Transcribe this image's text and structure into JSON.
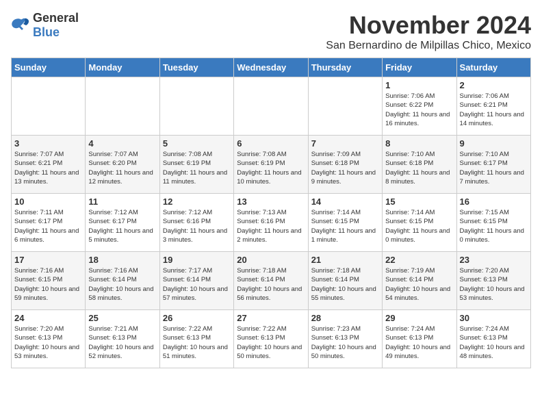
{
  "logo": {
    "general": "General",
    "blue": "Blue"
  },
  "title": "November 2024",
  "subtitle": "San Bernardino de Milpillas Chico, Mexico",
  "headers": [
    "Sunday",
    "Monday",
    "Tuesday",
    "Wednesday",
    "Thursday",
    "Friday",
    "Saturday"
  ],
  "weeks": [
    [
      {
        "day": "",
        "info": ""
      },
      {
        "day": "",
        "info": ""
      },
      {
        "day": "",
        "info": ""
      },
      {
        "day": "",
        "info": ""
      },
      {
        "day": "",
        "info": ""
      },
      {
        "day": "1",
        "info": "Sunrise: 7:06 AM\nSunset: 6:22 PM\nDaylight: 11 hours and 16 minutes."
      },
      {
        "day": "2",
        "info": "Sunrise: 7:06 AM\nSunset: 6:21 PM\nDaylight: 11 hours and 14 minutes."
      }
    ],
    [
      {
        "day": "3",
        "info": "Sunrise: 7:07 AM\nSunset: 6:21 PM\nDaylight: 11 hours and 13 minutes."
      },
      {
        "day": "4",
        "info": "Sunrise: 7:07 AM\nSunset: 6:20 PM\nDaylight: 11 hours and 12 minutes."
      },
      {
        "day": "5",
        "info": "Sunrise: 7:08 AM\nSunset: 6:19 PM\nDaylight: 11 hours and 11 minutes."
      },
      {
        "day": "6",
        "info": "Sunrise: 7:08 AM\nSunset: 6:19 PM\nDaylight: 11 hours and 10 minutes."
      },
      {
        "day": "7",
        "info": "Sunrise: 7:09 AM\nSunset: 6:18 PM\nDaylight: 11 hours and 9 minutes."
      },
      {
        "day": "8",
        "info": "Sunrise: 7:10 AM\nSunset: 6:18 PM\nDaylight: 11 hours and 8 minutes."
      },
      {
        "day": "9",
        "info": "Sunrise: 7:10 AM\nSunset: 6:17 PM\nDaylight: 11 hours and 7 minutes."
      }
    ],
    [
      {
        "day": "10",
        "info": "Sunrise: 7:11 AM\nSunset: 6:17 PM\nDaylight: 11 hours and 6 minutes."
      },
      {
        "day": "11",
        "info": "Sunrise: 7:12 AM\nSunset: 6:17 PM\nDaylight: 11 hours and 5 minutes."
      },
      {
        "day": "12",
        "info": "Sunrise: 7:12 AM\nSunset: 6:16 PM\nDaylight: 11 hours and 3 minutes."
      },
      {
        "day": "13",
        "info": "Sunrise: 7:13 AM\nSunset: 6:16 PM\nDaylight: 11 hours and 2 minutes."
      },
      {
        "day": "14",
        "info": "Sunrise: 7:14 AM\nSunset: 6:15 PM\nDaylight: 11 hours and 1 minute."
      },
      {
        "day": "15",
        "info": "Sunrise: 7:14 AM\nSunset: 6:15 PM\nDaylight: 11 hours and 0 minutes."
      },
      {
        "day": "16",
        "info": "Sunrise: 7:15 AM\nSunset: 6:15 PM\nDaylight: 11 hours and 0 minutes."
      }
    ],
    [
      {
        "day": "17",
        "info": "Sunrise: 7:16 AM\nSunset: 6:15 PM\nDaylight: 10 hours and 59 minutes."
      },
      {
        "day": "18",
        "info": "Sunrise: 7:16 AM\nSunset: 6:14 PM\nDaylight: 10 hours and 58 minutes."
      },
      {
        "day": "19",
        "info": "Sunrise: 7:17 AM\nSunset: 6:14 PM\nDaylight: 10 hours and 57 minutes."
      },
      {
        "day": "20",
        "info": "Sunrise: 7:18 AM\nSunset: 6:14 PM\nDaylight: 10 hours and 56 minutes."
      },
      {
        "day": "21",
        "info": "Sunrise: 7:18 AM\nSunset: 6:14 PM\nDaylight: 10 hours and 55 minutes."
      },
      {
        "day": "22",
        "info": "Sunrise: 7:19 AM\nSunset: 6:14 PM\nDaylight: 10 hours and 54 minutes."
      },
      {
        "day": "23",
        "info": "Sunrise: 7:20 AM\nSunset: 6:13 PM\nDaylight: 10 hours and 53 minutes."
      }
    ],
    [
      {
        "day": "24",
        "info": "Sunrise: 7:20 AM\nSunset: 6:13 PM\nDaylight: 10 hours and 53 minutes."
      },
      {
        "day": "25",
        "info": "Sunrise: 7:21 AM\nSunset: 6:13 PM\nDaylight: 10 hours and 52 minutes."
      },
      {
        "day": "26",
        "info": "Sunrise: 7:22 AM\nSunset: 6:13 PM\nDaylight: 10 hours and 51 minutes."
      },
      {
        "day": "27",
        "info": "Sunrise: 7:22 AM\nSunset: 6:13 PM\nDaylight: 10 hours and 50 minutes."
      },
      {
        "day": "28",
        "info": "Sunrise: 7:23 AM\nSunset: 6:13 PM\nDaylight: 10 hours and 50 minutes."
      },
      {
        "day": "29",
        "info": "Sunrise: 7:24 AM\nSunset: 6:13 PM\nDaylight: 10 hours and 49 minutes."
      },
      {
        "day": "30",
        "info": "Sunrise: 7:24 AM\nSunset: 6:13 PM\nDaylight: 10 hours and 48 minutes."
      }
    ]
  ]
}
